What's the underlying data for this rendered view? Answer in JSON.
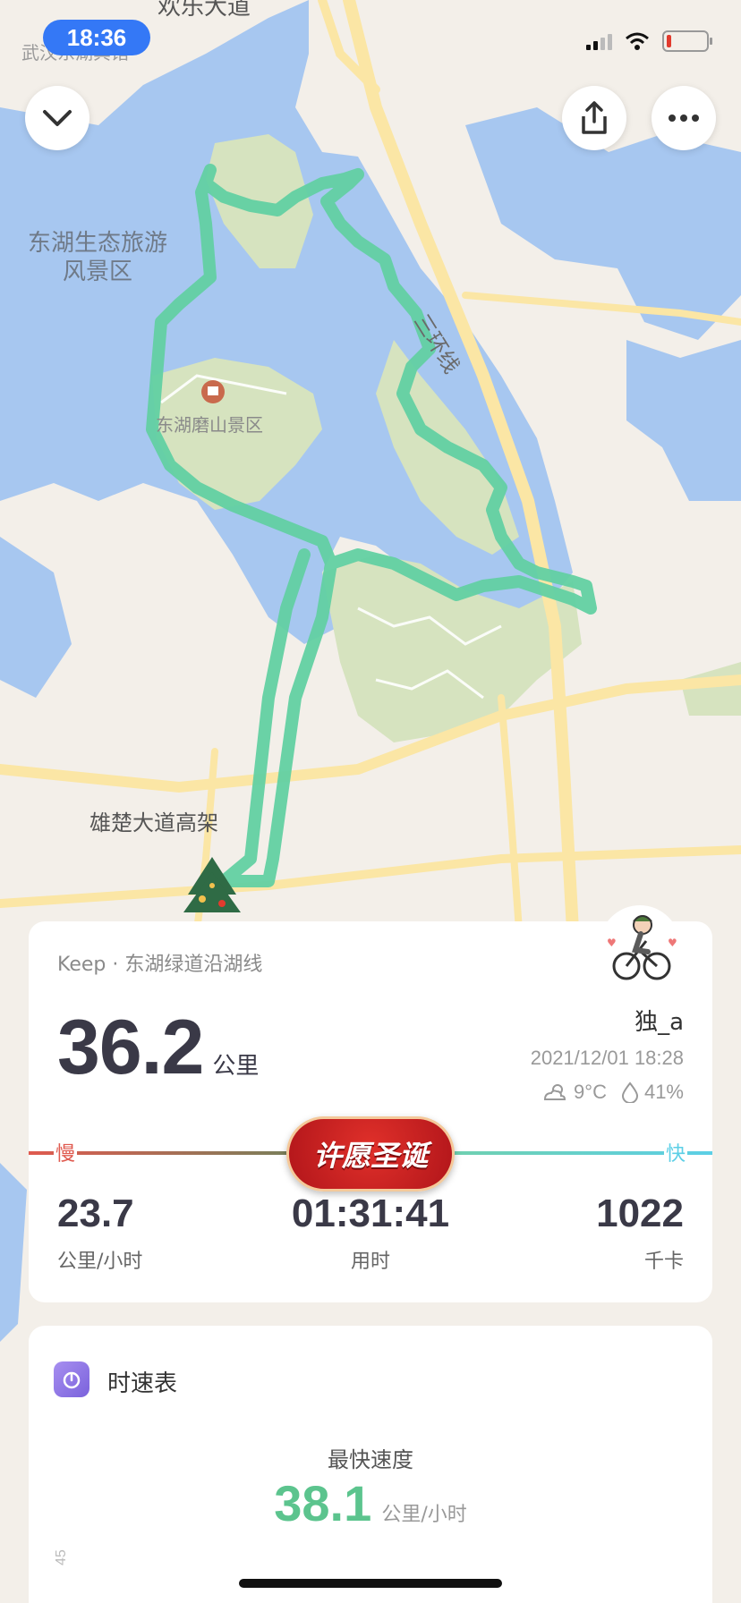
{
  "status_bar": {
    "time": "18:36"
  },
  "map": {
    "labels": {
      "road_top": "欢乐大道",
      "corner": "武汉东湖宾馆",
      "scenic_area": "东湖生态旅游风景区",
      "moshan": "东湖磨山景区",
      "ring_road": "三环线",
      "xiongchu": "雄楚大道高架"
    },
    "colors": {
      "water": "#a7c7f0",
      "park": "#d6e3bf",
      "land": "#f3efe9",
      "road": "#fbe6a5",
      "route": "#62d0a2"
    }
  },
  "header": {
    "collapse_icon": "chevron-down-icon",
    "share_icon": "share-icon",
    "more_icon": "more-icon"
  },
  "summary": {
    "route_title": "Keep · 东湖绿道沿湖线",
    "distance_value": "36.2",
    "distance_unit": "公里",
    "username": "独_a",
    "datetime": "2021/12/01 18:28",
    "temperature": "9°C",
    "humidity": "41%",
    "slow_label": "慢",
    "fast_label": "快",
    "christmas_button": "许愿圣诞",
    "avg_speed_value": "23.7",
    "avg_speed_label": "公里/小时",
    "duration_value": "01:31:41",
    "duration_label": "用时",
    "calories_value": "1022",
    "calories_label": "千卡"
  },
  "speed_chart": {
    "title": "时速表",
    "max_label": "最快速度",
    "max_value": "38.1",
    "max_unit": "公里/小时",
    "axis_tick": "45"
  }
}
